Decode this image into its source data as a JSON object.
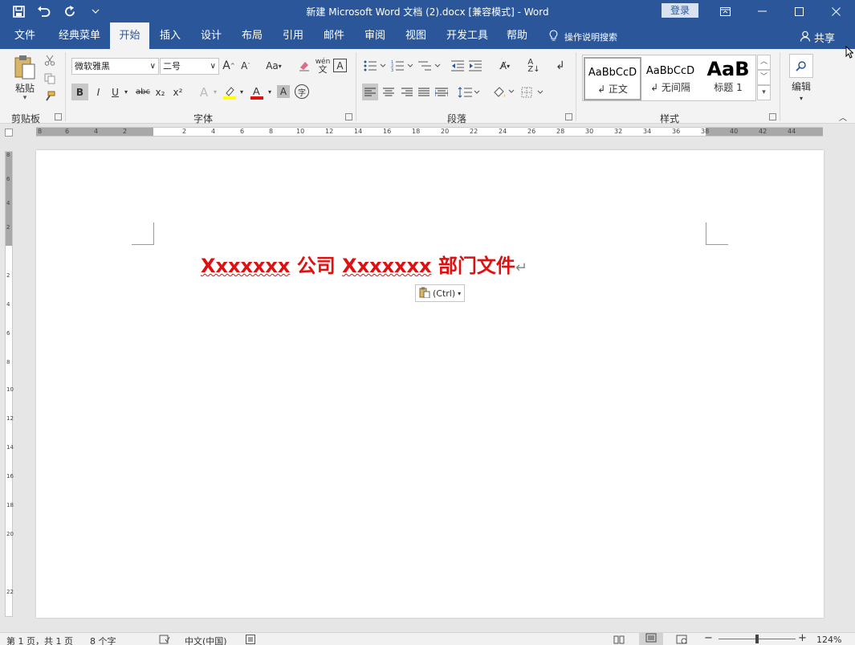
{
  "window": {
    "title": "新建 Microsoft Word 文档 (2).docx [兼容模式] - Word",
    "login_label": "登录",
    "share_label": "共享",
    "tell_me_placeholder": "操作说明搜索"
  },
  "quick_access": [
    "save-icon",
    "undo-icon",
    "redo-icon",
    "customize-icon"
  ],
  "tabs": [
    {
      "label": "文件"
    },
    {
      "label": "经典菜单"
    },
    {
      "label": "开始"
    },
    {
      "label": "插入"
    },
    {
      "label": "设计"
    },
    {
      "label": "布局"
    },
    {
      "label": "引用"
    },
    {
      "label": "邮件"
    },
    {
      "label": "审阅"
    },
    {
      "label": "视图"
    },
    {
      "label": "开发工具"
    },
    {
      "label": "帮助"
    }
  ],
  "active_tab": "开始",
  "ribbon": {
    "groups": {
      "clipboard": "剪贴板",
      "font": "字体",
      "paragraph": "段落",
      "styles": "样式"
    },
    "paste_label": "粘贴",
    "font_name": "微软雅黑",
    "font_size": "二号",
    "font_buttons": [
      "B",
      "I",
      "U",
      "abc",
      "x₂",
      "x²"
    ],
    "aa_label": "Aa",
    "wen_label": "wén",
    "styles": [
      {
        "sample": "AaBbCcD",
        "name": "↲ 正文"
      },
      {
        "sample": "AaBbCcD",
        "name": "↲ 无间隔"
      },
      {
        "sample": "AaB",
        "name": "标题 1"
      }
    ],
    "edit_label": "编辑"
  },
  "ruler": {
    "h_labels": [
      "8",
      "6",
      "4",
      "2",
      "2",
      "4",
      "6",
      "8",
      "10",
      "12",
      "14",
      "16",
      "18",
      "20",
      "22",
      "24",
      "26",
      "28",
      "30",
      "32",
      "34",
      "36",
      "38",
      "40",
      "42",
      "44"
    ],
    "v_labels": [
      "8",
      "6",
      "4",
      "2",
      "2",
      "4",
      "6",
      "8",
      "10",
      "12",
      "14",
      "16",
      "18",
      "20",
      "22"
    ]
  },
  "document": {
    "heading_part1": "Xxxxxxx",
    "heading_part2": " 公司 ",
    "heading_part3": "Xxxxxxx",
    "heading_part4": " 部门文件",
    "paragraph_mark": "↵",
    "paste_options_label": "(Ctrl)"
  },
  "status": {
    "page": "第 1 页，共 1 页",
    "words": "8 个字",
    "language": "中文(中国)",
    "zoom": "124%"
  },
  "colors": {
    "brand": "#2b579a",
    "heading": "#e01010"
  }
}
